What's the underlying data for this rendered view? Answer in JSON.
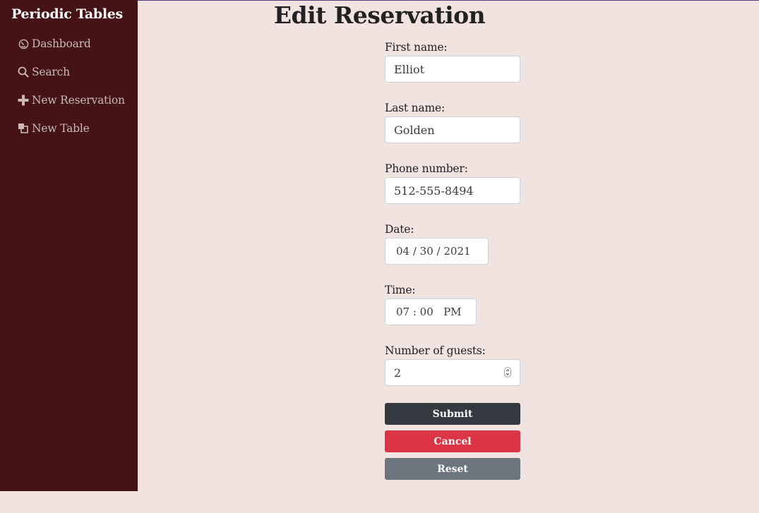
{
  "app": {
    "brand": "Periodic Tables"
  },
  "sidebar": {
    "items": [
      {
        "label": "Dashboard",
        "icon": "dashboard-gauge-icon"
      },
      {
        "label": "Search",
        "icon": "search-icon"
      },
      {
        "label": "New Reservation",
        "icon": "plus-icon"
      },
      {
        "label": "New Table",
        "icon": "layers-icon"
      }
    ]
  },
  "page": {
    "title": "Edit Reservation"
  },
  "form": {
    "first_name": {
      "label": "First name:",
      "value": "Elliot"
    },
    "last_name": {
      "label": "Last name:",
      "value": "Golden"
    },
    "phone": {
      "label": "Phone number:",
      "value": "512-555-8494"
    },
    "date": {
      "label": "Date:",
      "value": "04 / 30 / 2021"
    },
    "time": {
      "label": "Time:",
      "value": "07 : 00   PM"
    },
    "guests": {
      "label": "Number of guests:",
      "value": "2"
    }
  },
  "buttons": {
    "submit": "Submit",
    "cancel": "Cancel",
    "reset": "Reset"
  },
  "colors": {
    "sidebar": "#451216",
    "background": "#f1e3e0",
    "submit": "#343a40",
    "cancel": "#dc3545",
    "reset": "#6c757d"
  }
}
